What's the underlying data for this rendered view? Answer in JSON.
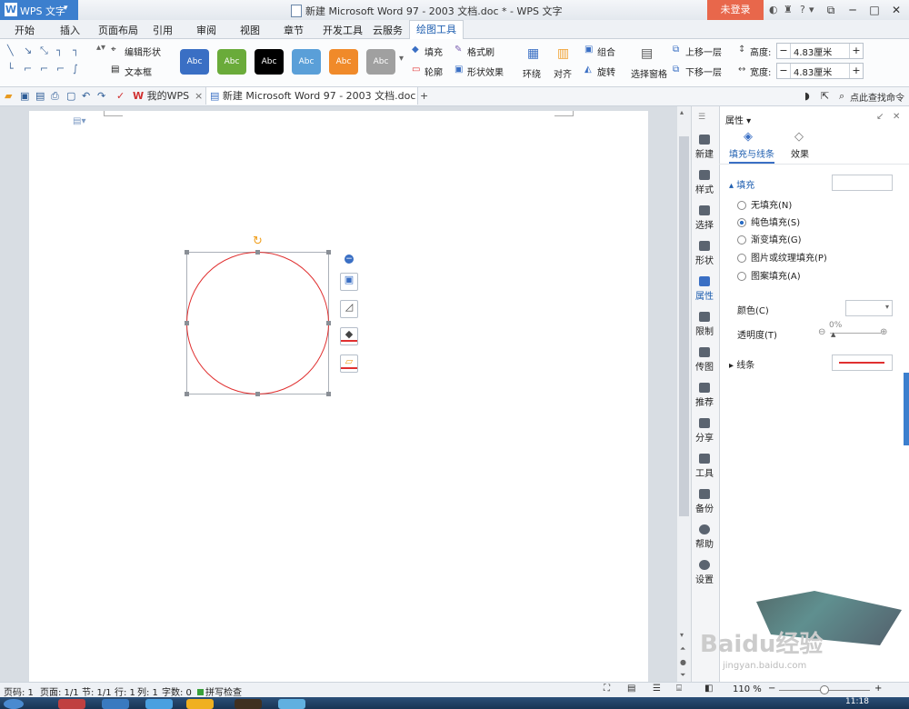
{
  "titlebar": {
    "app_name": "WPS 文字",
    "app_logo": "W",
    "title": "新建 Microsoft Word 97 - 2003 文档.doc * - WPS 文字",
    "login_label": "未登录",
    "help_label": "?"
  },
  "menu_tabs": [
    "开始",
    "插入",
    "页面布局",
    "引用",
    "审阅",
    "视图",
    "章节",
    "开发工具",
    "云服务",
    "绘图工具"
  ],
  "ribbon": {
    "edit_shape": "编辑形状",
    "text_box": "文本框",
    "style_label": "Abc",
    "style_colors": [
      "#3a6fc4",
      "#6aab3a",
      "#000000",
      "#5a9fd8",
      "#f08a2a",
      "#a0a0a0"
    ],
    "fill": "填充",
    "format_brush": "格式刷",
    "outline": "轮廓",
    "shape_effects": "形状效果",
    "wrap": "环绕",
    "align": "对齐",
    "group": "组合",
    "rotate": "旋转",
    "selection_pane": "选择窗格",
    "bring_forward": "上移一层",
    "send_backward": "下移一层",
    "height_label": "高度:",
    "height_value": "4.83厘米",
    "width_label": "宽度:",
    "width_value": "4.83厘米"
  },
  "doc_tabs": {
    "my_wps": "我的WPS",
    "document": "新建 Microsoft Word 97 - 2003 文档.doc *",
    "add": "+"
  },
  "search_command": "点此查找命令",
  "sidebar": [
    "新建",
    "样式",
    "选择",
    "形状",
    "属性",
    "限制",
    "传图",
    "推荐",
    "分享",
    "工具",
    "备份",
    "帮助",
    "设置"
  ],
  "properties": {
    "title": "属性",
    "tab_fill_line": "填充与线条",
    "tab_effects": "效果",
    "fill_section": "填充",
    "fill_options": [
      "无填充(N)",
      "纯色填充(S)",
      "渐变填充(G)",
      "图片或纹理填充(P)",
      "图案填充(A)"
    ],
    "color_label": "颜色(C)",
    "transparency_label": "透明度(T)",
    "transparency_value": "0%",
    "line_label": "线条"
  },
  "statusbar": {
    "page_num": "页码: 1",
    "pages": "页面: 1/1",
    "section": "节: 1/1",
    "row": "行: 1",
    "col": "列: 1",
    "word_count": "字数: 0",
    "spell_check": "拼写检查",
    "zoom": "110 %"
  },
  "taskbar": {
    "clock": "11:18"
  },
  "watermark": {
    "brand": "Baidu经验",
    "url": "jingyan.baidu.com"
  },
  "colors": {
    "accent": "#3c7fce",
    "login": "#e8674b",
    "shape_stroke": "#e03030"
  }
}
